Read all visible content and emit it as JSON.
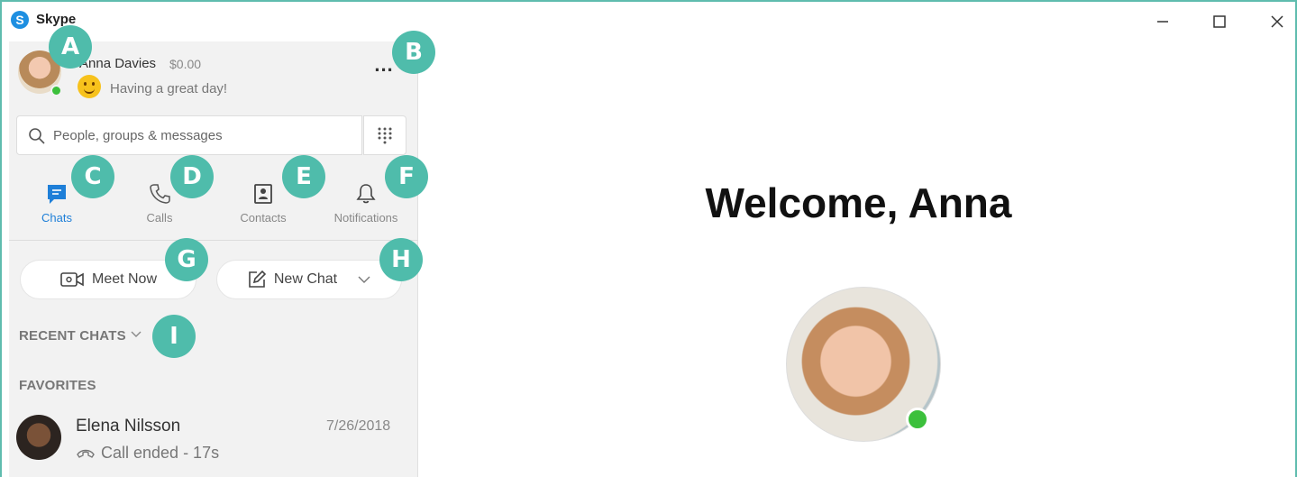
{
  "window": {
    "title": "Skype",
    "logo_letter": "S"
  },
  "profile": {
    "name": "Anna Davies",
    "credit": "$0.00",
    "mood": "Having a great day!",
    "presence": "online",
    "more_label": "..."
  },
  "search": {
    "placeholder": "People, groups & messages",
    "value": ""
  },
  "tabs": [
    {
      "label": "Chats",
      "icon": "chat-icon",
      "active": true
    },
    {
      "label": "Calls",
      "icon": "phone-icon",
      "active": false
    },
    {
      "label": "Contacts",
      "icon": "contacts-icon",
      "active": false
    },
    {
      "label": "Notifications",
      "icon": "bell-icon",
      "active": false
    }
  ],
  "actions": {
    "meet_now": "Meet Now",
    "new_chat": "New Chat"
  },
  "sections": {
    "recent": "RECENT CHATS",
    "favorites": "FAVORITES"
  },
  "chats": [
    {
      "name": "Elena Nilsson",
      "date": "7/26/2018",
      "status": "Call ended - 17s"
    }
  ],
  "main": {
    "welcome": "Welcome, Anna"
  },
  "callouts": [
    "A",
    "B",
    "C",
    "D",
    "E",
    "F",
    "G",
    "H",
    "I"
  ],
  "colors": {
    "accent": "#1e7fd8",
    "callout": "#4fbcab",
    "presence": "#3cc03c",
    "window_border": "#5fbcae"
  }
}
